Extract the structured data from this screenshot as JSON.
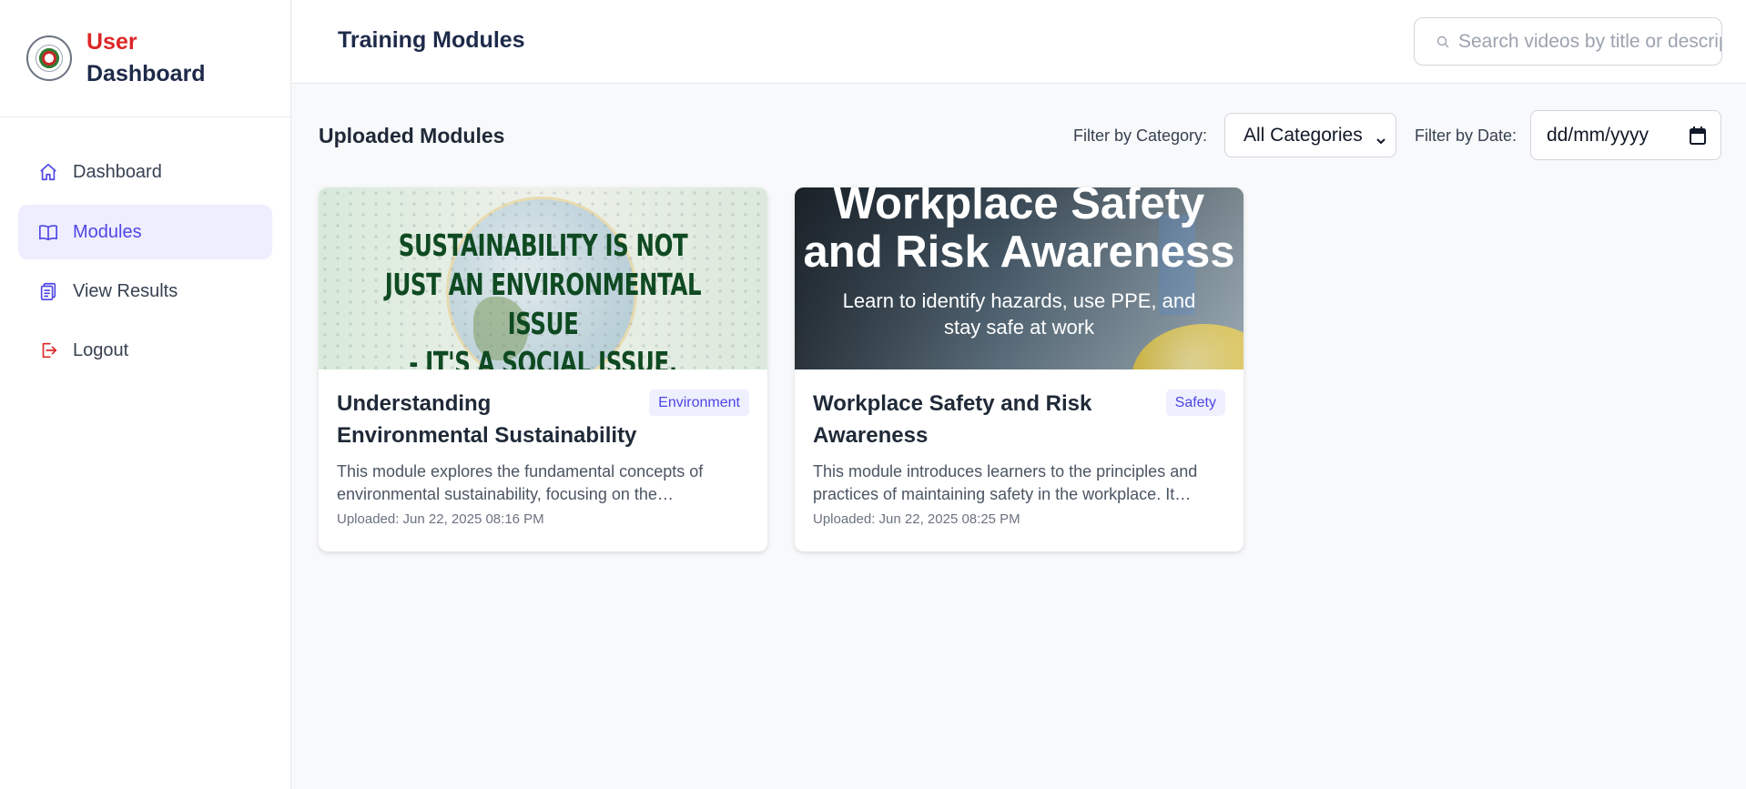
{
  "sidebar": {
    "brand_line1": "User",
    "brand_line2": "Dashboard",
    "items": [
      {
        "label": "Dashboard",
        "icon": "home-icon",
        "active": false
      },
      {
        "label": "Modules",
        "icon": "book-icon",
        "active": true
      },
      {
        "label": "View Results",
        "icon": "clipboard-icon",
        "active": false
      },
      {
        "label": "Logout",
        "icon": "logout-icon",
        "active": false
      }
    ]
  },
  "header": {
    "title": "Training Modules",
    "search_placeholder": "Search videos by title or description"
  },
  "main": {
    "section_title": "Uploaded Modules",
    "filter_category_label": "Filter by Category:",
    "filter_category_value": "All Categories",
    "filter_date_label": "Filter by Date:",
    "filter_date_value": "dd/mm/yyyy"
  },
  "modules": [
    {
      "thumb_text": "SUSTAINABILITY IS NOT\nJUST AN ENVIRONMENTAL ISSUE\n- IT'S A SOCIAL ISSUE, TOO.",
      "title": "Understanding Environmental Sustainability",
      "category": "Environment",
      "description": "This module explores the fundamental concepts of environmental sustainability, focusing on the…",
      "uploaded": "Uploaded: Jun 22, 2025 08:16 PM"
    },
    {
      "thumb_title": "Workplace Safety and Risk Awareness",
      "thumb_subtitle": "Learn to identify hazards, use PPE, and stay safe at work",
      "title": "Workplace Safety and Risk Awareness",
      "category": "Safety",
      "description": "This module introduces learners to the principles and practices of maintaining safety in the workplace. It…",
      "uploaded": "Uploaded: Jun 22, 2025 08:25 PM"
    }
  ],
  "colors": {
    "accent": "#4f46e5",
    "brand_red": "#dc2626",
    "brand_navy": "#1e2a4a",
    "active_bg": "#eeeefe",
    "logout_icon": "#dc2626"
  }
}
